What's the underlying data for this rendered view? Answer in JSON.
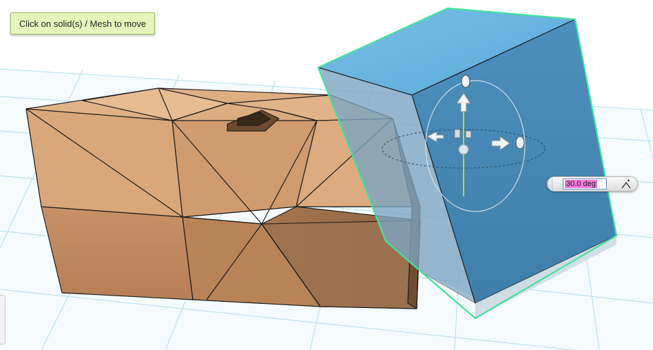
{
  "hint": {
    "text": "Click on solid(s) / Mesh to move"
  },
  "rotation_widget": {
    "value": "30.0 deg",
    "snap_icon": "snap-angle-icon"
  },
  "scene": {
    "grid_color": "#a9dbe9",
    "wood_light": "#dcab80",
    "wood_mid": "#c9956a",
    "wood_dark": "#9b7050",
    "box_top": "#6ab3de",
    "box_face": "#4f8fbd",
    "selection_outline": "#43e19a"
  },
  "icons": [
    "move-arrow-up-icon",
    "move-arrow-right-icon",
    "move-arrow-left-icon",
    "rotate-handle-icon",
    "scale-handle-icon"
  ]
}
